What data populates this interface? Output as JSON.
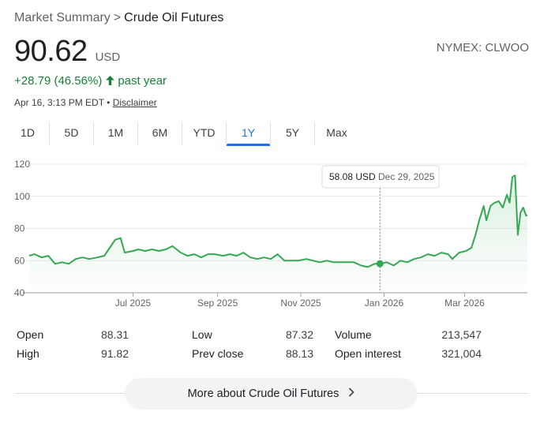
{
  "breadcrumb": {
    "parent": "Market Summary",
    "separator": ">",
    "current": "Crude Oil Futures"
  },
  "price": {
    "value": "90.62",
    "currency": "USD"
  },
  "exchange": "NYMEX: CLWOO",
  "change": {
    "text": "+28.79 (46.56%)",
    "period": "past year",
    "color": "#188038"
  },
  "timestamp": {
    "text": "Apr 16, 3:13 PM EDT •",
    "disclaimer": "Disclaimer"
  },
  "tabs": [
    {
      "label": "1D",
      "active": false
    },
    {
      "label": "5D",
      "active": false
    },
    {
      "label": "1M",
      "active": false
    },
    {
      "label": "6M",
      "active": false
    },
    {
      "label": "YTD",
      "active": false
    },
    {
      "label": "1Y",
      "active": true
    },
    {
      "label": "5Y",
      "active": false
    },
    {
      "label": "Max",
      "active": false
    }
  ],
  "chart_data": {
    "type": "line",
    "ylim": [
      40,
      120
    ],
    "yticks": [
      40,
      60,
      80,
      100,
      120
    ],
    "xticks": [
      "Jul 2025",
      "Sep 2025",
      "Nov 2025",
      "Jan 2026",
      "Mar 2026"
    ],
    "xtick_dates": [
      "2025-07-01",
      "2025-09-01",
      "2025-11-01",
      "2026-01-01",
      "2026-03-01"
    ],
    "xlim": [
      "2025-04-16",
      "2026-04-16"
    ],
    "line_color": "#34a853",
    "grid": true,
    "tooltip": {
      "value": "58.08 USD",
      "date": "Dec 29, 2025",
      "x": "2025-12-29",
      "y": 58.08
    },
    "series": [
      {
        "values": [
          [
            "2025-04-16",
            63
          ],
          [
            "2025-04-20",
            64
          ],
          [
            "2025-04-25",
            62
          ],
          [
            "2025-04-30",
            63
          ],
          [
            "2025-05-05",
            58
          ],
          [
            "2025-05-10",
            59
          ],
          [
            "2025-05-15",
            58
          ],
          [
            "2025-05-20",
            61
          ],
          [
            "2025-05-25",
            62
          ],
          [
            "2025-05-30",
            61
          ],
          [
            "2025-06-05",
            62
          ],
          [
            "2025-06-10",
            63
          ],
          [
            "2025-06-14",
            68
          ],
          [
            "2025-06-18",
            73
          ],
          [
            "2025-06-22",
            74
          ],
          [
            "2025-06-25",
            65
          ],
          [
            "2025-07-01",
            66
          ],
          [
            "2025-07-05",
            67
          ],
          [
            "2025-07-10",
            66
          ],
          [
            "2025-07-15",
            67
          ],
          [
            "2025-07-20",
            66
          ],
          [
            "2025-07-25",
            67
          ],
          [
            "2025-07-30",
            69
          ],
          [
            "2025-08-05",
            65
          ],
          [
            "2025-08-10",
            63
          ],
          [
            "2025-08-15",
            64
          ],
          [
            "2025-08-20",
            62
          ],
          [
            "2025-08-25",
            64
          ],
          [
            "2025-08-30",
            64
          ],
          [
            "2025-09-05",
            63
          ],
          [
            "2025-09-10",
            64
          ],
          [
            "2025-09-15",
            63
          ],
          [
            "2025-09-20",
            65
          ],
          [
            "2025-09-25",
            62
          ],
          [
            "2025-09-30",
            61
          ],
          [
            "2025-10-05",
            62
          ],
          [
            "2025-10-10",
            61
          ],
          [
            "2025-10-15",
            64
          ],
          [
            "2025-10-20",
            60
          ],
          [
            "2025-10-25",
            60
          ],
          [
            "2025-10-30",
            60
          ],
          [
            "2025-11-05",
            61
          ],
          [
            "2025-11-10",
            60
          ],
          [
            "2025-11-15",
            59
          ],
          [
            "2025-11-20",
            60
          ],
          [
            "2025-11-25",
            59
          ],
          [
            "2025-11-30",
            59
          ],
          [
            "2025-12-05",
            59
          ],
          [
            "2025-12-10",
            59
          ],
          [
            "2025-12-15",
            57
          ],
          [
            "2025-12-20",
            56
          ],
          [
            "2025-12-25",
            58
          ],
          [
            "2025-12-29",
            58.08
          ],
          [
            "2026-01-03",
            59
          ],
          [
            "2026-01-08",
            57
          ],
          [
            "2026-01-13",
            60
          ],
          [
            "2026-01-18",
            59
          ],
          [
            "2026-01-23",
            61
          ],
          [
            "2026-01-28",
            62
          ],
          [
            "2026-02-02",
            64
          ],
          [
            "2026-02-07",
            63
          ],
          [
            "2026-02-12",
            65
          ],
          [
            "2026-02-17",
            64
          ],
          [
            "2026-02-20",
            61
          ],
          [
            "2026-02-25",
            65
          ],
          [
            "2026-03-02",
            66
          ],
          [
            "2026-03-06",
            68
          ],
          [
            "2026-03-09",
            76
          ],
          [
            "2026-03-12",
            86
          ],
          [
            "2026-03-15",
            94
          ],
          [
            "2026-03-17",
            85
          ],
          [
            "2026-03-20",
            94
          ],
          [
            "2026-03-23",
            96
          ],
          [
            "2026-03-26",
            97
          ],
          [
            "2026-03-29",
            93
          ],
          [
            "2026-04-01",
            101
          ],
          [
            "2026-04-03",
            96
          ],
          [
            "2026-04-05",
            112
          ],
          [
            "2026-04-07",
            113
          ],
          [
            "2026-04-09",
            76
          ],
          [
            "2026-04-11",
            90
          ],
          [
            "2026-04-13",
            93
          ],
          [
            "2026-04-15",
            88
          ],
          [
            "2026-04-16",
            88.31
          ]
        ]
      }
    ]
  },
  "stats": {
    "open": {
      "label": "Open",
      "value": "88.31"
    },
    "high": {
      "label": "High",
      "value": "91.82"
    },
    "low": {
      "label": "Low",
      "value": "87.32"
    },
    "prev_close": {
      "label": "Prev close",
      "value": "88.13"
    },
    "volume": {
      "label": "Volume",
      "value": "213,547"
    },
    "open_interest": {
      "label": "Open interest",
      "value": "321,004"
    }
  },
  "more_button": {
    "label": "More about Crude Oil Futures"
  }
}
